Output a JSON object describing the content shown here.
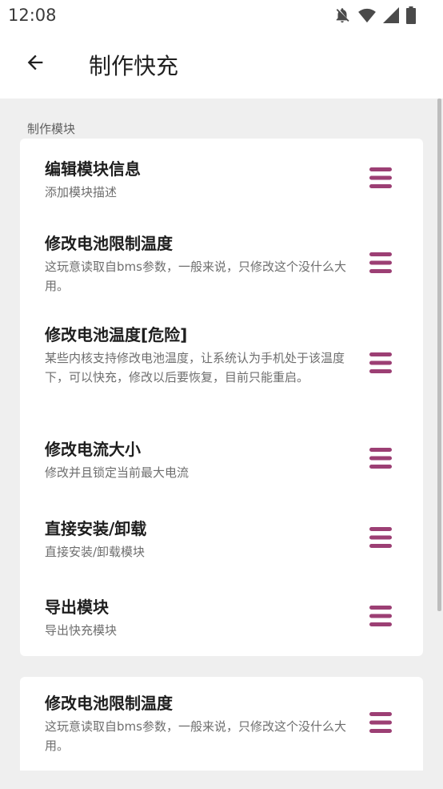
{
  "status_bar": {
    "time": "12:08",
    "icons": [
      "notifications-off-icon",
      "wifi-icon",
      "signal-icon",
      "battery-icon"
    ]
  },
  "app_bar": {
    "back_icon": "arrow-left-icon",
    "title": "制作快充"
  },
  "section": {
    "title": "制作模块"
  },
  "module_items": [
    {
      "title": "编辑模块信息",
      "description": "添加模块描述",
      "icon": "menu-icon"
    },
    {
      "title": "修改电池限制温度",
      "description": "这玩意读取自bms参数，一般来说，只修改这个没什么大用。",
      "icon": "menu-icon"
    },
    {
      "title": "修改电池温度[危险]",
      "description": "某些内核支持修改电池温度，让系统认为手机处于该温度下，可以快充，修改以后要恢复，目前只能重启。",
      "icon": "menu-icon"
    },
    {
      "title": "修改电流大小",
      "description": "修改并且锁定当前最大电流",
      "icon": "menu-icon"
    },
    {
      "title": "直接安装/卸载",
      "description": "直接安装/卸载模块",
      "icon": "menu-icon"
    },
    {
      "title": "导出模块",
      "description": "导出快充模块",
      "icon": "menu-icon"
    }
  ],
  "second_card": {
    "title": "修改电池限制温度",
    "description": "这玩意读取自bms参数，一般来说，只修改这个没什么大用。",
    "icon": "menu-icon"
  },
  "colors": {
    "accent": "#9c3f74",
    "background": "#efefef",
    "card": "#ffffff"
  }
}
